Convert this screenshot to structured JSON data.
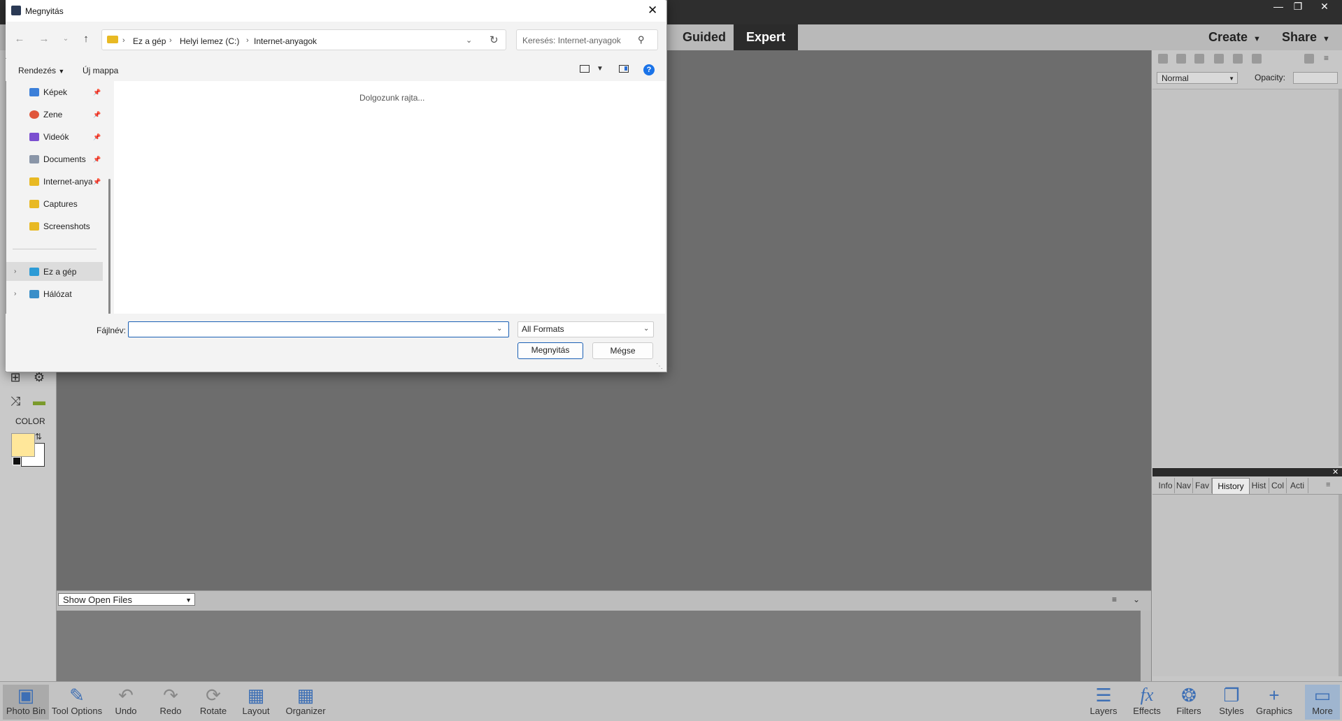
{
  "app": {
    "modes": [
      "Guided",
      "Expert"
    ],
    "menus": [
      "Create",
      "Share"
    ],
    "bin_select": "Show Open Files",
    "blend_mode": "Normal",
    "opacity_label": "Opacity:",
    "panel_tabs": [
      "Info",
      "Nav",
      "Fav",
      "History",
      "Hist",
      "Col",
      "Acti"
    ],
    "color_label": "COLOR",
    "fg_color": "#ffe79a",
    "bg_color": "#ffffff",
    "bottom_items": [
      {
        "label": "Photo Bin",
        "icon": "photo-bin-icon"
      },
      {
        "label": "Tool Options",
        "icon": "tool-options-icon"
      },
      {
        "label": "Undo",
        "icon": "undo-icon"
      },
      {
        "label": "Redo",
        "icon": "redo-icon"
      },
      {
        "label": "Rotate",
        "icon": "rotate-icon"
      },
      {
        "label": "Layout",
        "icon": "layout-icon"
      },
      {
        "label": "Organizer",
        "icon": "organizer-icon"
      },
      {
        "label": "Layers",
        "icon": "layers-icon"
      },
      {
        "label": "Effects",
        "icon": "effects-icon"
      },
      {
        "label": "Filters",
        "icon": "filters-icon"
      },
      {
        "label": "Styles",
        "icon": "styles-icon"
      },
      {
        "label": "Graphics",
        "icon": "graphics-icon"
      },
      {
        "label": "More",
        "icon": "more-icon"
      }
    ]
  },
  "dialog": {
    "title": "Megnyitás",
    "breadcrumb": [
      "Ez a gép",
      "Helyi lemez (C:)",
      "Internet-anyagok"
    ],
    "search_placeholder": "Keresés: Internet-anyagok",
    "organize": "Rendezés",
    "new_folder": "Új mappa",
    "nav_items": [
      {
        "label": "Képek",
        "icon": "pictures-icon"
      },
      {
        "label": "Zene",
        "icon": "music-icon"
      },
      {
        "label": "Videók",
        "icon": "videos-icon"
      },
      {
        "label": "Documents",
        "icon": "documents-icon"
      },
      {
        "label": "Internet-anyagok",
        "icon": "folder-icon"
      },
      {
        "label": "Captures",
        "icon": "folder-icon"
      },
      {
        "label": "Screenshots",
        "icon": "folder-icon"
      }
    ],
    "this_pc": "Ez a gép",
    "network": "Hálózat",
    "working_text": "Dolgozunk rajta...",
    "filename_label": "Fájlnév:",
    "filename_value": "",
    "format": "All Formats",
    "open_button": "Megnyitás",
    "cancel_button": "Mégse"
  }
}
